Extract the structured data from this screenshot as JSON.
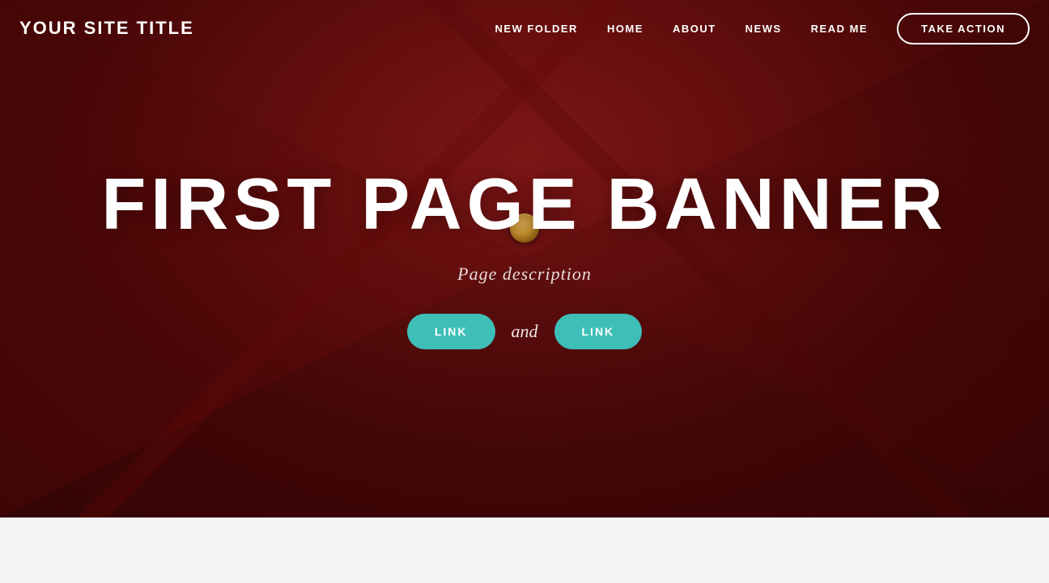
{
  "header": {
    "site_title": "YOUR SITE TITLE",
    "nav": {
      "items": [
        {
          "label": "NEW FOLDER",
          "id": "new-folder"
        },
        {
          "label": "HOME",
          "id": "home"
        },
        {
          "label": "ABOUT",
          "id": "about"
        },
        {
          "label": "NEWS",
          "id": "news"
        },
        {
          "label": "READ ME",
          "id": "read-me"
        }
      ],
      "cta_label": "TAKE ACTION"
    }
  },
  "hero": {
    "title": "FIRST PAGE BANNER",
    "description": "Page description",
    "link1_label": "LINK",
    "and_text": "and",
    "link2_label": "LINK"
  },
  "colors": {
    "accent": "#3dbfb8",
    "bg_dark": "#6b1010",
    "white": "#ffffff"
  }
}
